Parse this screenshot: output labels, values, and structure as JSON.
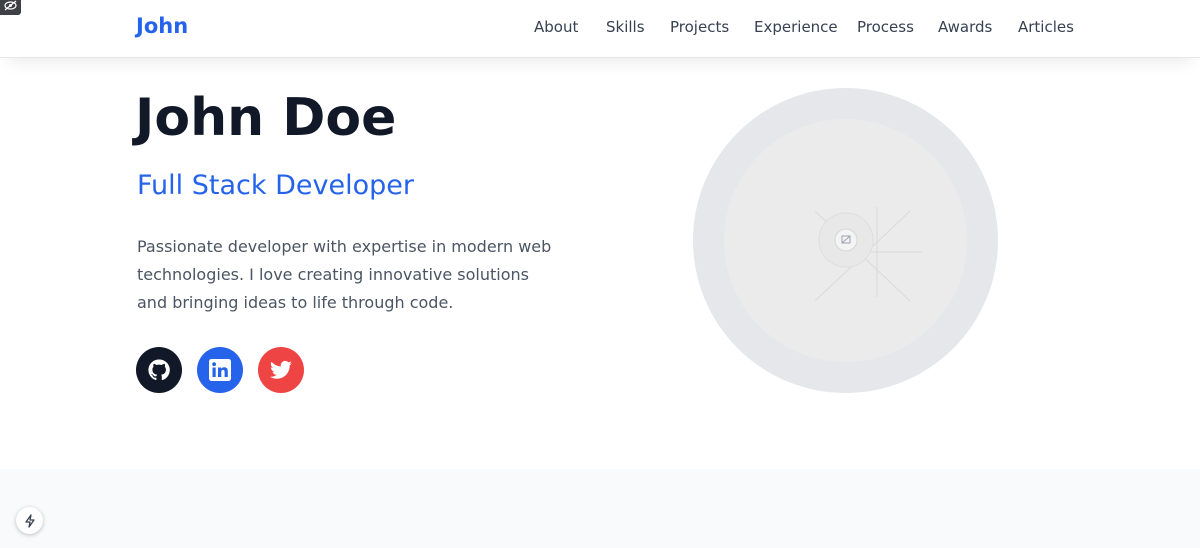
{
  "header": {
    "brand": "John",
    "nav": [
      "About",
      "Skills",
      "Projects",
      "Experience",
      "Process",
      "Awards",
      "Articles"
    ]
  },
  "hero": {
    "name": "John Doe",
    "role": "Full Stack Developer",
    "description": "Passionate developer with expertise in modern web technologies. I love creating innovative solutions and bringing ideas to life through code."
  },
  "social": [
    {
      "icon": "github-icon",
      "color": "#111827"
    },
    {
      "icon": "linkedin-icon",
      "color": "#2563eb"
    },
    {
      "icon": "twitter-icon",
      "color": "#ef4444"
    }
  ],
  "colors": {
    "accent": "#2563eb",
    "dark": "#111827",
    "twitter": "#ef4444"
  }
}
